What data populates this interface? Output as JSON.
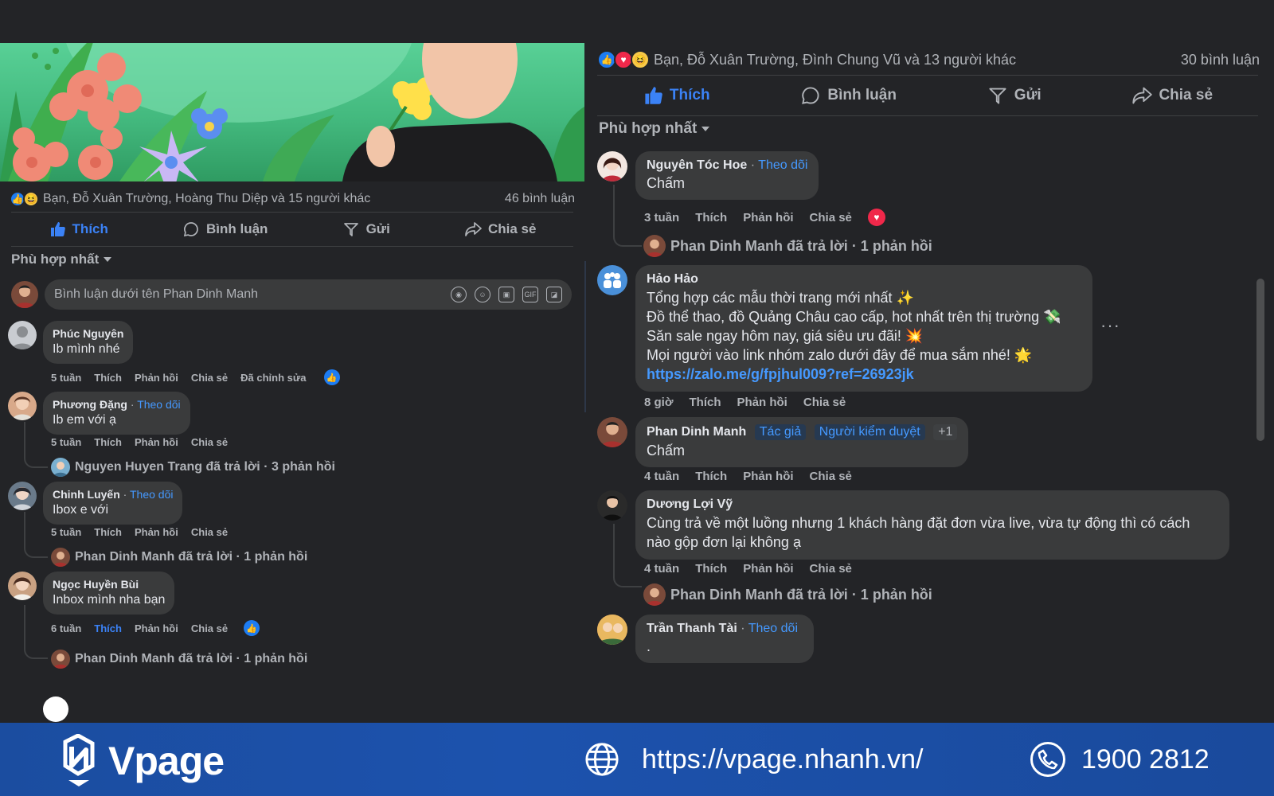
{
  "left": {
    "reactions_text": "Bạn, Đỗ Xuân Trường, Hoàng Thu Diệp và 15 người khác",
    "comment_count": "46 bình luận",
    "actions": {
      "like": "Thích",
      "comment": "Bình luận",
      "send": "Gửi",
      "share": "Chia sẻ"
    },
    "sort": "Phù hợp nhất",
    "composer_placeholder": "Bình luận dưới tên Phan Dinh Manh",
    "comments": [
      {
        "name": "Phúc Nguyên",
        "follow": "",
        "text": "Ib mình nhé",
        "time": "5 tuần",
        "like": "Thích",
        "reply": "Phản hồi",
        "share": "Chia sẻ",
        "edited": "Đã chỉnh sửa"
      },
      {
        "name": "Phương Đặng",
        "follow": "Theo dõi",
        "text": "Ib em với ạ",
        "time": "5 tuần",
        "like": "Thích",
        "reply": "Phản hồi",
        "share": "Chia sẻ",
        "reply_summary": "Nguyen Huyen Trang đã trả lời · 3 phản hồi"
      },
      {
        "name": "Chinh Luyến",
        "follow": "Theo dõi",
        "text": "Ibox e với",
        "time": "5 tuần",
        "like": "Thích",
        "reply": "Phản hồi",
        "share": "Chia sẻ",
        "reply_summary": "Phan Dinh Manh đã trả lời · 1 phản hồi"
      },
      {
        "name": "Ngọc Huyền Bùi",
        "follow": "",
        "text": "Inbox mình nha bạn",
        "time": "6 tuần",
        "like": "Thích",
        "reply": "Phản hồi",
        "share": "Chia sẻ",
        "reply_summary": "Phan Dinh Manh đã trả lời · 1 phản hồi"
      }
    ]
  },
  "right": {
    "reactions_text": "Bạn, Đỗ Xuân Trường, Đình Chung Vũ và 13 người khác",
    "comment_count": "30 bình luận",
    "actions": {
      "like": "Thích",
      "comment": "Bình luận",
      "send": "Gửi",
      "share": "Chia sẻ"
    },
    "sort": "Phù hợp nhất",
    "comments": [
      {
        "name": "Nguyên Tóc Hoe",
        "follow": "Theo dõi",
        "text": "Chấm",
        "time": "3 tuần",
        "like": "Thích",
        "reply": "Phản hồi",
        "share": "Chia sẻ",
        "reply_summary": "Phan Dinh Manh đã trả lời · 1 phản hồi"
      },
      {
        "name": "Hảo Hảo",
        "lines": [
          "Tổng hợp các mẫu thời trang mới nhất ✨",
          "Đồ thể thao, đồ Quảng Châu cao cấp, hot nhất trên thị trường 💸",
          "Săn sale ngay hôm nay, giá siêu ưu đãi! 💥",
          "Mọi người vào link nhóm zalo dưới đây để mua sắm nhé! 🌟"
        ],
        "link": "https://zalo.me/g/fpjhul009?ref=26923jk",
        "time": "8 giờ",
        "like": "Thích",
        "reply": "Phản hồi",
        "share": "Chia sẻ",
        "more": "···"
      },
      {
        "name": "Phan Dinh Manh",
        "badge_author": "Tác giả",
        "badge_mod": "Người kiểm duyệt",
        "badge_plus": "+1",
        "text": "Chấm",
        "time": "4 tuần",
        "like": "Thích",
        "reply": "Phản hồi",
        "share": "Chia sẻ"
      },
      {
        "name": "Dương Lợi Vỹ",
        "lines": [
          "Cùng trả về một luồng nhưng 1 khách hàng đặt đơn vừa live, vừa tự động thì có cách",
          "nào gộp đơn lại không ạ"
        ],
        "time": "4 tuần",
        "like": "Thích",
        "reply": "Phản hồi",
        "share": "Chia sẻ",
        "reply_summary": "Phan Dinh Manh đã trả lời · 1 phản hồi"
      },
      {
        "name": "Trần Thanh Tài",
        "follow": "Theo dõi",
        "text": "."
      }
    ]
  },
  "footer": {
    "brand": "Vpage",
    "url": "https://vpage.nhanh.vn/",
    "phone": "1900 2812"
  },
  "colors": {
    "background": "#232427",
    "bubble": "#3a3b3c",
    "accent": "#3b82f6",
    "footer": "#1c52ad"
  }
}
